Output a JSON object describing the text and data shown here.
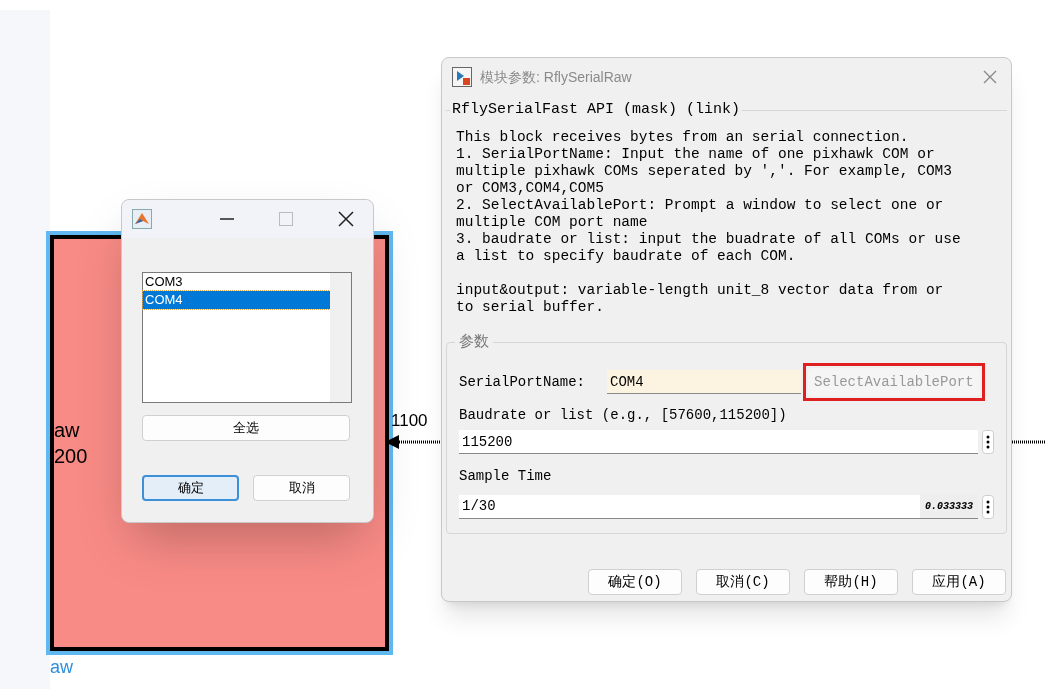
{
  "canvas": {
    "block": {
      "lines": [
        "aw",
        "200"
      ],
      "name": "aw",
      "selected": true
    },
    "port_label": "1100"
  },
  "list_dialog": {
    "items": [
      {
        "label": "COM3",
        "selected": false
      },
      {
        "label": "COM4",
        "selected": true
      }
    ],
    "select_all": "全选",
    "buttons": [
      {
        "label": "确定",
        "default": true
      },
      {
        "label": "取消",
        "default": false
      }
    ]
  },
  "param_dialog": {
    "title": "模块参数: RflySerialRaw",
    "group_title": "RflySerialFast API (mask) (link)",
    "description": [
      "This block receives bytes from an serial connection.\n1. SerialPortName: Input the name of one pixhawk COM or\nmultiple pixhawk COMs seperated by ','. For example, COM3\nor COM3,COM4,COM5\n2. SelectAvailablePort: Prompt a window to select one or\nmultiple COM port name\n3. baudrate or list: input the buadrate of all COMs or use\na list to specify baudrate of each COM.",
      "input&output: variable-length unit_8 vector data from or\nto serial buffer."
    ],
    "params_title": "参数",
    "serial_port": {
      "label": "SerialPortName:",
      "value": "COM4",
      "button": "SelectAvailablePort",
      "highlighted": true
    },
    "baudrate": {
      "label": "Baudrate or list (e.g., [57600,115200])",
      "value": "115200"
    },
    "sample_time": {
      "label": "Sample Time",
      "value": "1/30",
      "evaluated": "0.033333"
    },
    "buttons": [
      "确定(O)",
      "取消(C)",
      "帮助(H)",
      "应用(A)"
    ]
  }
}
